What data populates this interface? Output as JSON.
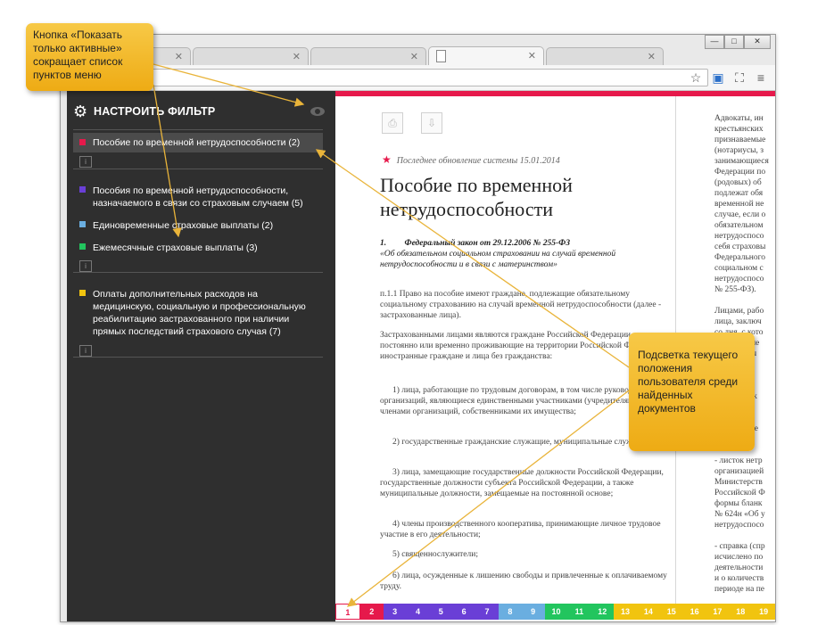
{
  "browser": {
    "window_controls": [
      "—",
      "□",
      "✕"
    ],
    "toolbar_icons": [
      "star-icon",
      "cast-icon",
      "fullscreen-icon",
      "menu-icon"
    ]
  },
  "sidebar": {
    "header_title": "НАСТРОИТЬ ФИЛЬТР",
    "info_label": "i",
    "items": [
      {
        "label": "Пособие по временной нетрудоспособности (2)",
        "color": "#e6194b",
        "active": true
      },
      {
        "label": "Пособия по временной нетрудоспособности, назначаемого в связи со страховым случаем (5)",
        "color": "#6a3fd6",
        "active": false
      },
      {
        "label": "Единовременные страховые выплаты (2)",
        "color": "#6aaee0",
        "active": false
      },
      {
        "label": "Ежемесячные страховые выплаты (3)",
        "color": "#22c55e",
        "active": false
      },
      {
        "label": "Оплаты дополнительных расходов на медицинскую, социальную и профессиональную реабилитацию застрахованного при наличии прямых последствий страхового случая (7)",
        "color": "#f1c40f",
        "active": false
      }
    ]
  },
  "document": {
    "last_update": "Последнее обновление системы 15.01.2014",
    "title": "Пособие по временной нетрудоспособности",
    "law_number": "1.",
    "law_title": "Федеральный закон от 29.12.2006 № 255-ФЗ",
    "law_subtitle": "«Об обязательном социальном страховании на случай временной нетрудоспособности и в связи с материнством»",
    "paragraphs": [
      "п.1.1   Право на пособие имеют граждане, подлежащие обязательному социальному страхованию на случай временной нетрудоспособности (далее - застрахованные лица).",
      "Застрахованными лицами являются граждане Российской Федерации, а также постоянно или временно проживающие на территории Российской Федерации иностранные граждане и лица без гражданства:",
      "1) лица, работающие по трудовым договорам, в том числе руководители организаций, являющиеся единственными участниками (учредителями), членами организаций, собственниками их имущества;",
      "2) государственные гражданские служащие, муниципальные служащие;",
      "3) лица, замещающие государственные должности Российской Федерации, государственные должности субъекта Российской Федерации, а также муниципальные должности, замещаемые на постоянной основе;",
      "4) члены производственного кооператива, принимающие личное трудовое участие в его деятельности;",
      "5) священнослужители;",
      "6) лица, осужденные к лишению свободы и привлеченные к оплачиваемому труду."
    ],
    "right_column": [
      "Адвокаты, ин",
      "крестьянских",
      "признаваемые",
      "(нотариусы, з",
      "занимающиеся",
      "Федерации по",
      "(родовых) об",
      "подлежат обя",
      "временной не",
      "случае, если о",
      "обязательном",
      "нетрудоспосо",
      "себя страховы",
      "Федерального",
      "социальном с",
      "нетрудоспосо",
      "№ 255-ФЗ).",
      "",
      "Лицами, рабо",
      "лица, заключ",
      "со дня, с кото",
      "или фактиче",
      "был заключ",
      "",
      "",
      "Приказ",
      "«Об утверж",
      "",
      "",
      "Для назначе",
      "представля",
      "",
      "- листок нетр",
      "организацией",
      "Министерств",
      "Российской Ф",
      "формы бланк",
      "№ 624н «Об у",
      "нетрудоспосо",
      "",
      "- справка (спр",
      "исчислено по",
      "деятельности",
      "и о количеств",
      "периоде на пе"
    ]
  },
  "pager": {
    "pages": [
      "1",
      "2",
      "3",
      "4",
      "5",
      "6",
      "7",
      "8",
      "9",
      "10",
      "11",
      "12",
      "13",
      "14",
      "15",
      "16",
      "17",
      "18",
      "19"
    ],
    "colors": [
      "#e6194b",
      "#e6194b",
      "#6a3fd6",
      "#6a3fd6",
      "#6a3fd6",
      "#6a3fd6",
      "#6a3fd6",
      "#6aaee0",
      "#6aaee0",
      "#22c55e",
      "#22c55e",
      "#22c55e",
      "#f1c40f",
      "#f1c40f",
      "#f1c40f",
      "#f1c40f",
      "#f1c40f",
      "#f1c40f",
      "#f1c40f"
    ],
    "current": "1"
  },
  "callouts": {
    "top_left": "Кнопка «Показать только активные» сокращает список пунктов меню",
    "right": "Подсветка текущего положения пользователя среди найденных документов"
  }
}
